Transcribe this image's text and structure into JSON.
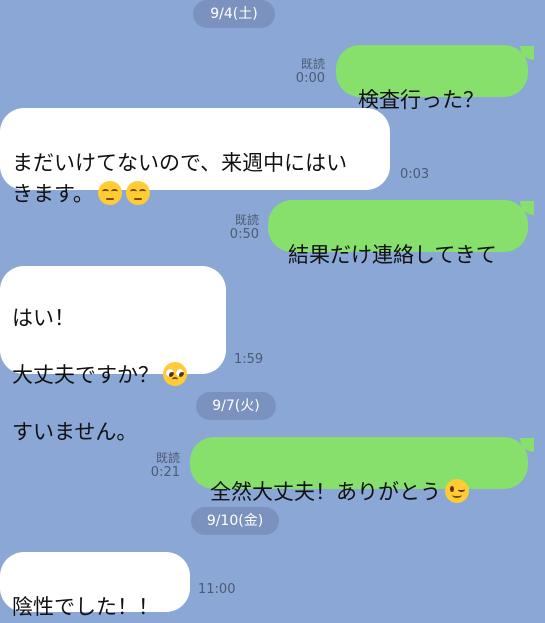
{
  "dates": {
    "d1": "9/4(土)",
    "d2": "9/7(火)",
    "d3": "9/10(金)"
  },
  "messages": [
    {
      "side": "right",
      "text": "検査行った？",
      "read": "既読",
      "time": "0:00"
    },
    {
      "side": "left",
      "text": "まだいけてないので、来週中にはい\nきます。",
      "emoji": [
        "pensive-face",
        "pensive-face"
      ],
      "time": "0:03"
    },
    {
      "side": "right",
      "text": "結果だけ連絡してきて",
      "read": "既読",
      "time": "0:50"
    },
    {
      "side": "left",
      "text_line1": "はい！",
      "text_line2": "大丈夫ですか？",
      "text_line3": "すいません。",
      "emoji": [
        "pleading-face"
      ],
      "time": "1:59"
    },
    {
      "side": "right",
      "text": "全然大丈夫！ありがとう",
      "emoji": [
        "winking-face"
      ],
      "read": "既読",
      "time": "0:21"
    },
    {
      "side": "left",
      "text": "陰性でした！！",
      "time": "11:00"
    }
  ],
  "colors": {
    "background": "#8aa7d6",
    "left_bubble": "#ffffff",
    "right_bubble": "#86e06b",
    "date_pill": "#7a92bd"
  }
}
